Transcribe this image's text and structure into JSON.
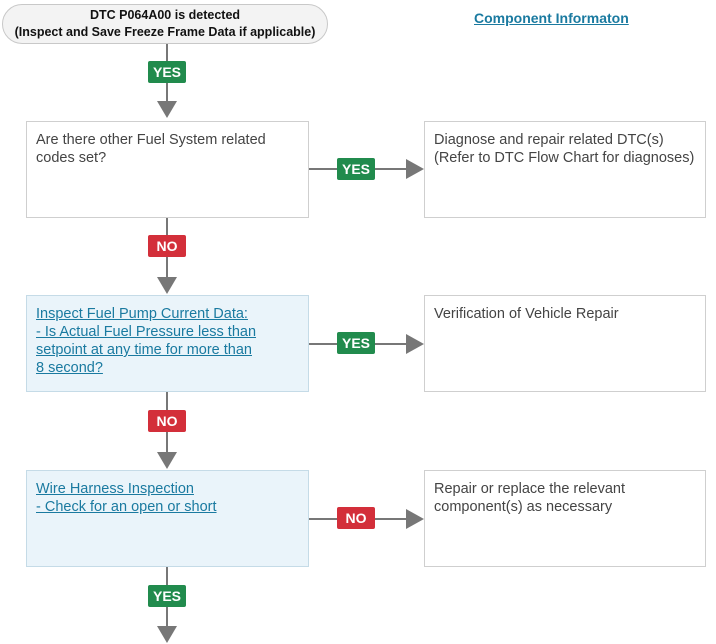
{
  "start": {
    "line1": "DTC P064A00 is detected",
    "line2": "(Inspect and Save Freeze Frame Data if applicable)"
  },
  "component_link": "Component Informaton",
  "boxes": {
    "q1": [
      "Are there other Fuel System related",
      "codes set?"
    ],
    "a1": [
      "Diagnose and repair related DTC(s)",
      "(Refer to DTC Flow Chart for diagnoses)"
    ],
    "q2": [
      "Inspect Fuel Pump Current Data:",
      "- Is Actual Fuel Pressure less than",
      "setpoint at any time for more than",
      "8 second?"
    ],
    "a2": [
      "Verification of Vehicle Repair"
    ],
    "q3": [
      "Wire Harness Inspection",
      "- Check for an open or short"
    ],
    "a3": [
      "Repair or replace the relevant",
      "component(s) as necessary"
    ]
  },
  "labels": {
    "yes": "YES",
    "no": "NO"
  },
  "colors": {
    "yes": "#218b4d",
    "no": "#d32f3a",
    "link": "#1a7aa0",
    "arrow": "#777777"
  }
}
